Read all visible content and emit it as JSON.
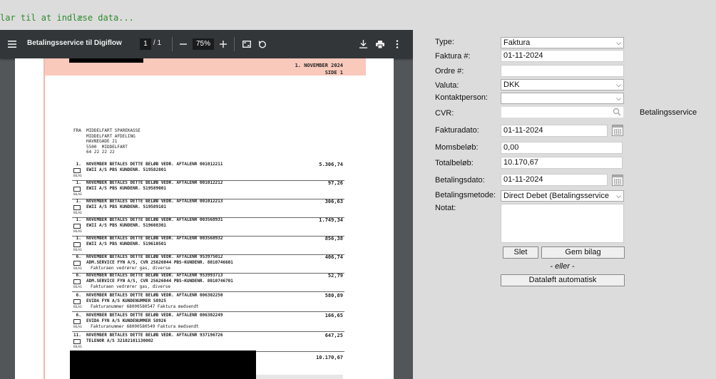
{
  "status_text": "lar til at indlæse data...",
  "viewer": {
    "title": "Betalingsservice til Digiflow",
    "page_current": "1",
    "page_total": "/  1",
    "zoom": "75%",
    "icons": {
      "menu": "menu-icon",
      "zoom_out": "minus-icon",
      "zoom_in": "plus-icon",
      "fit": "fit-page-icon",
      "rotate": "rotate-icon",
      "download": "download-icon",
      "print": "print-icon",
      "more": "more-vert-icon"
    }
  },
  "document": {
    "date_header": "1. NOVEMBER 2024",
    "side_label": "SIDE    1",
    "sender_lines": [
      "FRA  MIDDELFART SPAREKASSE",
      "     MIDDELFART AFDELING",
      "     HAVNEGADE 21",
      "     5500  MIDDELFART",
      "     64 22 22 22"
    ],
    "bilag_label": "BILAG",
    "rows": [
      {
        "l1": " 1.  NOVEMBER BETALES DETTE BELØB VEDR. AFTALENR 001012211",
        "l2": "EWII A/S PBS KUNDENR. 519582801",
        "l3": "",
        "amount": "5.306,74"
      },
      {
        "l1": " 1.  NOVEMBER BETALES DETTE BELØB VEDR. AFTALENR 001012212",
        "l2": "EWII A/S PBS KUNDENR. 519589001",
        "l3": "",
        "amount": "97,26"
      },
      {
        "l1": " 1.  NOVEMBER BETALES DETTE BELØB VEDR. AFTALENR 001012213",
        "l2": "EWII A/S PBS KUNDENR. 519589101",
        "l3": "",
        "amount": "306,63"
      },
      {
        "l1": " 1.  NOVEMBER BETALES DETTE BELØB VEDR. AFTALENR 003568931",
        "l2": "EWII A/S PBS KUNDENR. 519608301",
        "l3": "",
        "amount": "1.749,34"
      },
      {
        "l1": " 1.  NOVEMBER BETALES DETTE BELØB VEDR. AFTALENR 003568932",
        "l2": "EWII A/S PBS KUNDENR. 519610501",
        "l3": "",
        "amount": "856,38"
      },
      {
        "l1": " 6.  NOVEMBER BETALES DETTE BELØB VEDR. AFTALENR 953975012",
        "l2": "ADM.SERVICE FYN A/S, CVR 25626044 PBS-KUNDENR. 8010746601",
        "l3": "Fakturaen vedrører gas, diverse",
        "amount": "406,74"
      },
      {
        "l1": " 6.  NOVEMBER BETALES DETTE BELØB VEDR. AFTALENR 953993713",
        "l2": "ADM.SERVICE FYN A/S, CVR 25626044 PBS-KUNDENR. 8010746701",
        "l3": "Fakturaen vedrører gas, diverse",
        "amount": "52,79"
      },
      {
        "l1": " 6.  NOVEMBER BETALES DETTE BELØB VEDR. AFTALENR 006302250",
        "l2": "EVIDA FYN A/S KUNDENUMMER 58925",
        "l3": "Fakturanummer 68000580547 Faktura medsendt",
        "amount": "580,89"
      },
      {
        "l1": " 6.  NOVEMBER BETALES DETTE BELØB VEDR. AFTALENR 006302249",
        "l2": "EVIDA FYN A/S KUNDENUMMER 58926",
        "l3": "Fakturanummer 68000580549 Faktura medsendt",
        "amount": "166,65"
      },
      {
        "l1": "11.  NOVEMBER BETALES DETTE BELØB VEDR. AFTALENR 937196726",
        "l2": "TELENOR A/S 32102101130002",
        "l3": "",
        "amount": "647,25"
      }
    ],
    "total": "10.170,67"
  },
  "form": {
    "type_label": "Type:",
    "type_value": "Faktura",
    "faktura_label": "Faktura #:",
    "faktura_value": "01-11-2024",
    "ordre_label": "Ordre #:",
    "ordre_value": "",
    "valuta_label": "Valuta:",
    "valuta_value": "DKK",
    "kontakt_label": "Kontaktperson:",
    "kontakt_value": "",
    "cvr_label": "CVR:",
    "cvr_value": "",
    "cvr_result": "Betalingsservice",
    "fakturadato_label": "Fakturadato:",
    "fakturadato_value": "01-11-2024",
    "moms_label": "Momsbeløb:",
    "moms_value": "0,00",
    "total_label": "Totalbeløb:",
    "total_value": "10.170,67",
    "betalingsdato_label": "Betalingsdato:",
    "betalingsdato_value": "01-11-2024",
    "metode_label": "Betalingsmetode:",
    "metode_value": "Direct Debet (Betalingsservice",
    "notat_label": "Notat:",
    "notat_value": "",
    "slet_label": "Slet",
    "gem_label": "Gem bilag",
    "eller_label": "- eller -",
    "auto_label": "Dataløft automatisk"
  }
}
